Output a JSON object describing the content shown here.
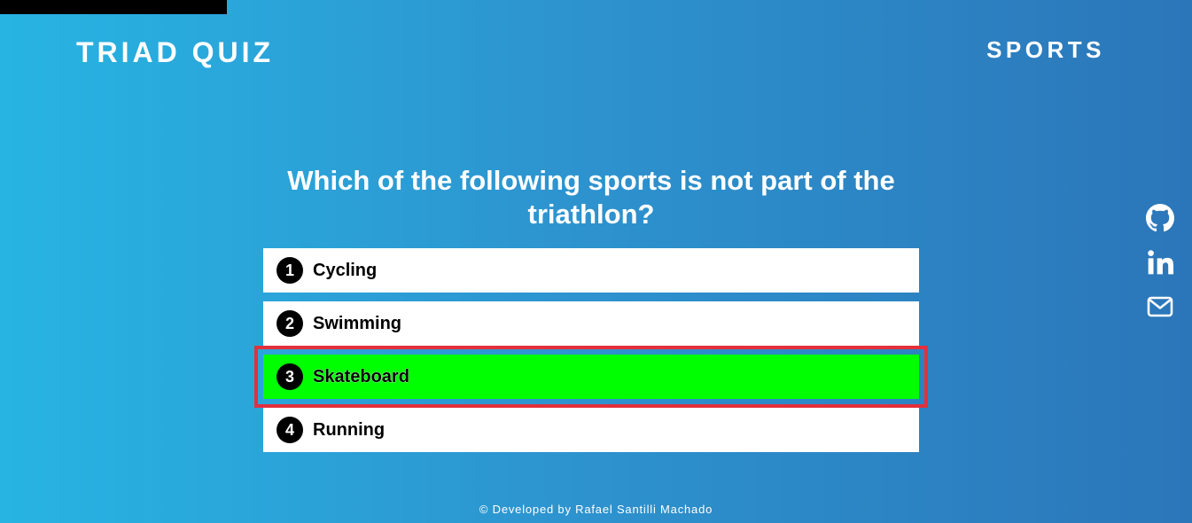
{
  "progress": {
    "fraction": 0.19
  },
  "header": {
    "brand": "TRIAD QUIZ",
    "category": "SPORTS"
  },
  "question": {
    "text": "Which of the following sports is not part of the triathlon?"
  },
  "options": [
    {
      "number": "1",
      "label": "Cycling",
      "correct": false
    },
    {
      "number": "2",
      "label": "Swimming",
      "correct": false
    },
    {
      "number": "3",
      "label": "Skateboard",
      "correct": true
    },
    {
      "number": "4",
      "label": "Running",
      "correct": false
    }
  ],
  "social": {
    "icons": [
      "github-icon",
      "linkedin-icon",
      "mail-icon"
    ]
  },
  "footer": {
    "text": "© Developed by Rafael Santilli Machado"
  },
  "colors": {
    "correct": "#00ff00",
    "highlight_border": "#e3303b",
    "progress": "#000000"
  }
}
